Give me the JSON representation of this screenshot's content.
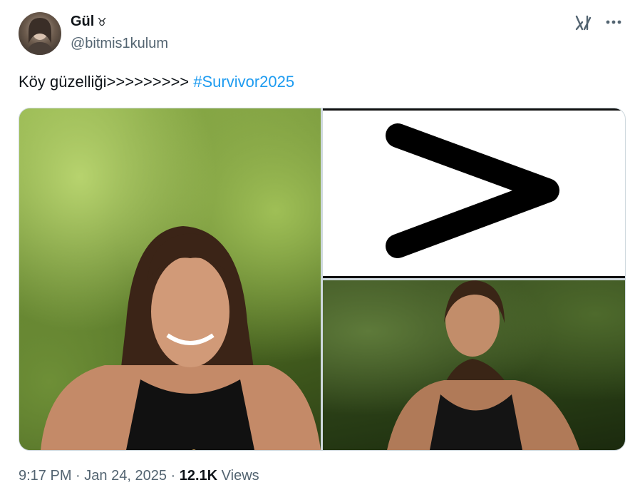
{
  "author": {
    "display_name": "Gül",
    "badge": "♉",
    "username": "@bitmis1kulum"
  },
  "tweet": {
    "text": "Köy güzelliği>>>>>>>>> ",
    "hashtag": "#Survivor2025"
  },
  "meta": {
    "time": "9:17 PM",
    "separator": "·",
    "date": "Jan 24, 2025",
    "views_count": "12.1K",
    "views_label": "Views"
  },
  "icons": {
    "grok": "grok-icon",
    "more": "more-icon"
  },
  "colors": {
    "accent": "#1d9bf0",
    "secondary_text": "#536471",
    "primary_text": "#0f1419"
  }
}
